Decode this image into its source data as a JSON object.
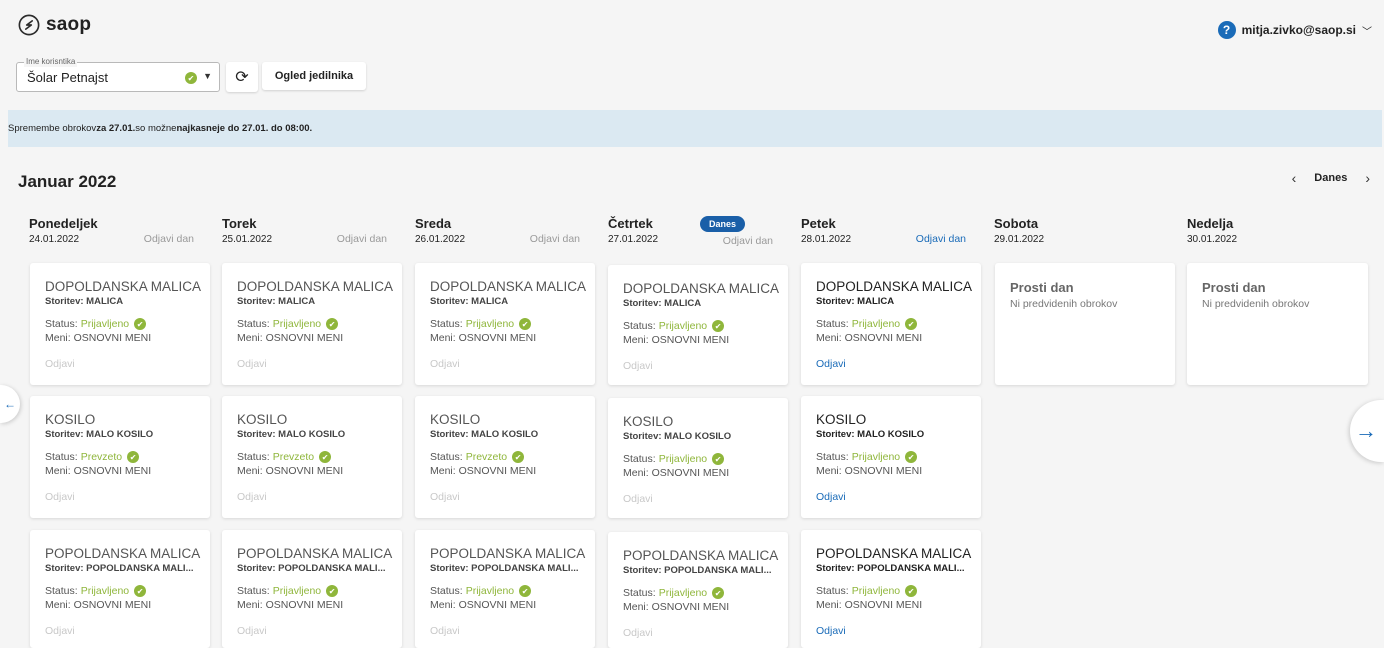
{
  "app": {
    "logo_text": "saop",
    "user_email": "mitja.zivko@saop.si",
    "help": "?"
  },
  "toolbar": {
    "select_label": "Ime korisntika",
    "select_value": "Šolar Petnajst",
    "refresh_icon": "⟳",
    "menu_button": "Ogled jedilnika"
  },
  "banner": {
    "part1": "Spremembe obrokov ",
    "part2": "za 27.01.",
    "part3": " so možne ",
    "part4": "najkasneje do 27.01. do 08:00."
  },
  "calendar": {
    "month": "Januar 2022",
    "today_label": "Danes",
    "days": [
      {
        "name": "Ponedeljek",
        "date": "24.01.2022",
        "odjavi": "Odjavi dan"
      },
      {
        "name": "Torek",
        "date": "25.01.2022",
        "odjavi": "Odjavi dan"
      },
      {
        "name": "Sreda",
        "date": "26.01.2022",
        "odjavi": "Odjavi dan"
      },
      {
        "name": "Četrtek",
        "date": "27.01.2022",
        "odjavi": "Odjavi dan",
        "badge": "Danes"
      },
      {
        "name": "Petek",
        "date": "28.01.2022",
        "odjavi": "Odjavi dan"
      },
      {
        "name": "Sobota",
        "date": "29.01.2022"
      },
      {
        "name": "Nedelja",
        "date": "30.01.2022"
      }
    ],
    "labels": {
      "status": "Status:",
      "odjavi": "Odjavi"
    },
    "meals": [
      [
        {
          "title": "DOPOLDANSKA MALICA",
          "service": "Storitev: MALICA",
          "status": "Prijavljeno",
          "menu": "Meni: OSNOVNI MENI"
        },
        {
          "title": "KOSILO",
          "service": "Storitev: MALO KOSILO",
          "status": "Prevzeto",
          "menu": "Meni: OSNOVNI MENI"
        },
        {
          "title": "POPOLDANSKA MALICA",
          "service": "Storitev: POPOLDANSKA MALI...",
          "status": "Prijavljeno",
          "menu": "Meni: OSNOVNI MENI"
        }
      ],
      [
        {
          "title": "DOPOLDANSKA MALICA",
          "service": "Storitev: MALICA",
          "status": "Prijavljeno",
          "menu": "Meni: OSNOVNI MENI"
        },
        {
          "title": "KOSILO",
          "service": "Storitev: MALO KOSILO",
          "status": "Prevzeto",
          "menu": "Meni: OSNOVNI MENI"
        },
        {
          "title": "POPOLDANSKA MALICA",
          "service": "Storitev: POPOLDANSKA MALI...",
          "status": "Prijavljeno",
          "menu": "Meni: OSNOVNI MENI"
        }
      ],
      [
        {
          "title": "DOPOLDANSKA MALICA",
          "service": "Storitev: MALICA",
          "status": "Prijavljeno",
          "menu": "Meni: OSNOVNI MENI"
        },
        {
          "title": "KOSILO",
          "service": "Storitev: MALO KOSILO",
          "status": "Prevzeto",
          "menu": "Meni: OSNOVNI MENI"
        },
        {
          "title": "POPOLDANSKA MALICA",
          "service": "Storitev: POPOLDANSKA MALI...",
          "status": "Prijavljeno",
          "menu": "Meni: OSNOVNI MENI"
        }
      ],
      [
        {
          "title": "DOPOLDANSKA MALICA",
          "service": "Storitev: MALICA",
          "status": "Prijavljeno",
          "menu": "Meni: OSNOVNI MENI"
        },
        {
          "title": "KOSILO",
          "service": "Storitev: MALO KOSILO",
          "status": "Prijavljeno",
          "menu": "Meni: OSNOVNI MENI"
        },
        {
          "title": "POPOLDANSKA MALICA",
          "service": "Storitev: POPOLDANSKA MALI...",
          "status": "Prijavljeno",
          "menu": "Meni: OSNOVNI MENI"
        }
      ],
      [
        {
          "title": "DOPOLDANSKA MALICA",
          "service": "Storitev: MALICA",
          "status": "Prijavljeno",
          "menu": "Meni: OSNOVNI MENI"
        },
        {
          "title": "KOSILO",
          "service": "Storitev: MALO KOSILO",
          "status": "Prijavljeno",
          "menu": "Meni: OSNOVNI MENI"
        },
        {
          "title": "POPOLDANSKA MALICA",
          "service": "Storitev: POPOLDANSKA MALI...",
          "status": "Prijavljeno",
          "menu": "Meni: OSNOVNI MENI"
        }
      ]
    ],
    "free_days": [
      {
        "title": "Prosti dan",
        "sub": "Ni predvidenih obrokov"
      },
      {
        "title": "Prosti dan",
        "sub": "Ni predvidenih obrokov"
      }
    ]
  },
  "colors": {
    "accent": "#1a6bb8",
    "ok": "#8fb63b",
    "banner": "#dbe9f2",
    "bg": "#f5f5f5"
  }
}
